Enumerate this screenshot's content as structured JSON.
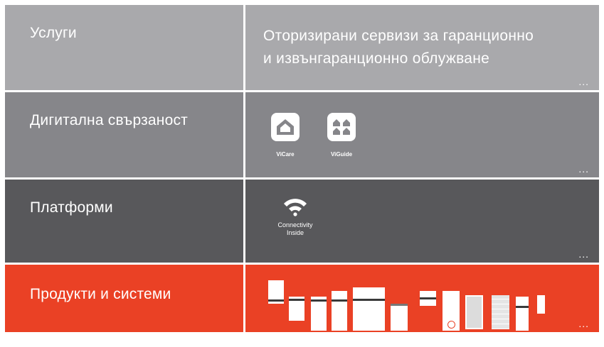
{
  "rows": [
    {
      "label": "Услуги",
      "desc_line1": "Оторизирани сервизи за гаранционно",
      "desc_line2": "и извънгаранционно облужване",
      "more": "...",
      "color": "#a9a9ac"
    },
    {
      "label": "Дигитална свързаност",
      "more": "...",
      "color": "#86868a"
    },
    {
      "label": "Платформи",
      "more": "...",
      "color": "#58585b"
    },
    {
      "label": "Продукти и системи",
      "more": "...",
      "color": "#ea4125"
    }
  ],
  "apps": {
    "vicare": {
      "name": "ViCare",
      "icon": "house-icon"
    },
    "viguide": {
      "name": "ViGuide",
      "icon": "multi-house-icon"
    }
  },
  "platform": {
    "line1": "Connectivity",
    "line2": "Inside",
    "icon": "wifi-icon"
  }
}
